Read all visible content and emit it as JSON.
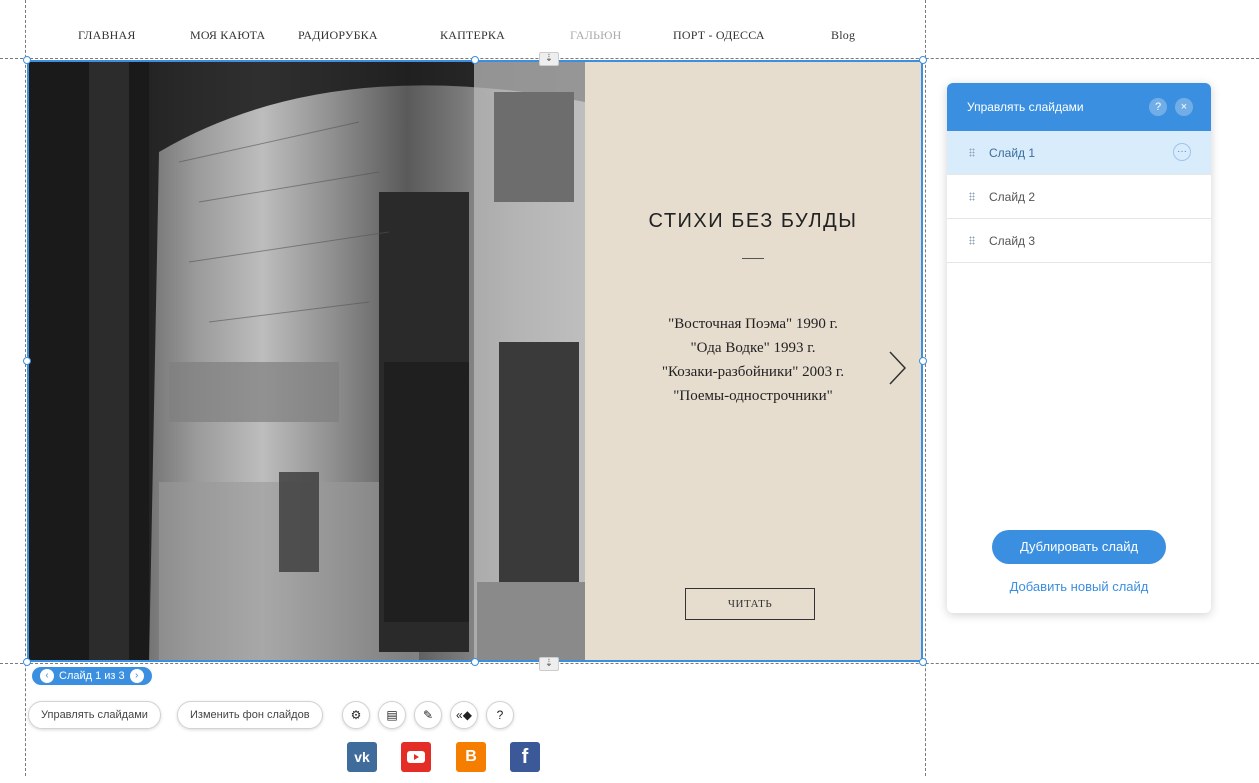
{
  "nav": {
    "items": [
      "ГЛАВНАЯ",
      "МОЯ КАЮТА",
      "РАДИОРУБКА",
      "КАПТЕРКА",
      "ГАЛЬЮН",
      "ПОРТ - ОДЕССА",
      "Blog"
    ]
  },
  "slide": {
    "title": "СТИХИ  БЕЗ  БУЛДЫ",
    "lines": [
      "\"Восточная Поэма\" 1990 г.",
      "\"Ода Водке\" 1993 г.",
      "\"Козаки-разбойники\" 2003 г.",
      "\"Поемы-однострочники\""
    ],
    "button_label": "ЧИТАТЬ"
  },
  "manager": {
    "title": "Управлять слайдами",
    "help_icon": "?",
    "close_icon": "×",
    "slides": [
      "Слайд 1",
      "Слайд 2",
      "Слайд 3"
    ],
    "more_icon": "···",
    "duplicate_label": "Дублировать слайд",
    "add_label": "Добавить новый слайд"
  },
  "toolbar": {
    "pager_label": "Слайд 1 из 3",
    "manage_label": "Управлять слайдами",
    "change_bg_label": "Изменить фон слайдов"
  },
  "social": {
    "vk": "vk",
    "blogger": "B",
    "facebook": "f"
  },
  "colors": {
    "accent": "#3b8fe0",
    "panel_bg": "#e6ddcf"
  }
}
